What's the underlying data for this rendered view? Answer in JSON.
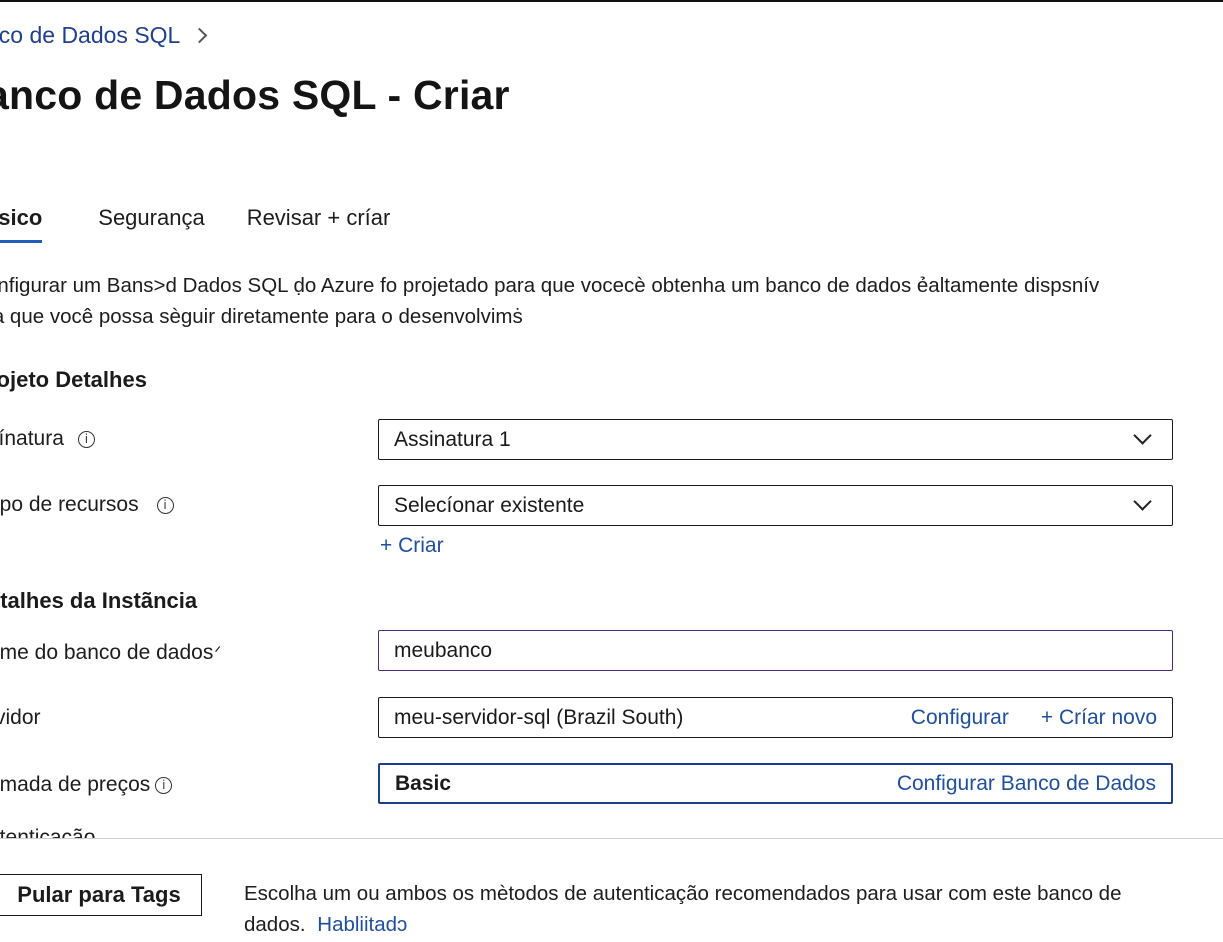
{
  "breadcrumb": {
    "items": [
      {
        "label": "nco de Dados SQL"
      }
    ]
  },
  "page": {
    "title": "anco de Dados SQL - Criar"
  },
  "tabs": [
    {
      "label": "ásico",
      "active": true
    },
    {
      "label": "Segurança",
      "active": false
    },
    {
      "label": "Revisar + críar",
      "active": false
    }
  ],
  "description": {
    "line1": "onfigurar um Bans>d Dados SQL ḍo Azure fo projetado para que vocecè obtenha um banco de dados ẻaltamente dispsnív",
    "line2": "ra que você possa sèguir diretamente para o desenvolvimṡ"
  },
  "sections": {
    "project": "rojeto Detalhes",
    "instance": "etalhes da Instãncia",
    "auth": "utenticação"
  },
  "fields": {
    "subscription": {
      "label": "sínatura",
      "value": "Assinatura 1",
      "info": "i"
    },
    "resource_group": {
      "label": "upo de recursos",
      "value": "Selecíonar existente",
      "info": "i",
      "create_link": "+ Criar"
    },
    "db_name": {
      "label": "ome do banco de dados",
      "value": "meubanco",
      "required_mark": "ᐟ"
    },
    "server": {
      "label": "rvidor",
      "value": "meu-servidor-sql (Brazil South)",
      "configure_link": "Configurar",
      "create_new_link": "+ Críar novo"
    },
    "pricing_tier": {
      "label": "amada de preços",
      "value": "Basic",
      "info": "i",
      "configure_link": "Configurar Banco de Dados"
    }
  },
  "footer": {
    "button_label": "Pular para Tags",
    "text_line1": "Escolha um ou ambos os mètodos de autenticação recomendados para usar com este banco de",
    "text_line2": "dados.",
    "enabled_link": "Habliitadɔ"
  },
  "colors": {
    "link": "#1f4fa0",
    "tab_underline": "#1f5fb8",
    "active_input_border": "#4b2a86",
    "tier_border": "#1b3f8f"
  },
  "icons": {
    "info": "info-icon",
    "dropdown": "chevron-down-icon",
    "breadcrumb_separator": "chevron-right-icon"
  }
}
